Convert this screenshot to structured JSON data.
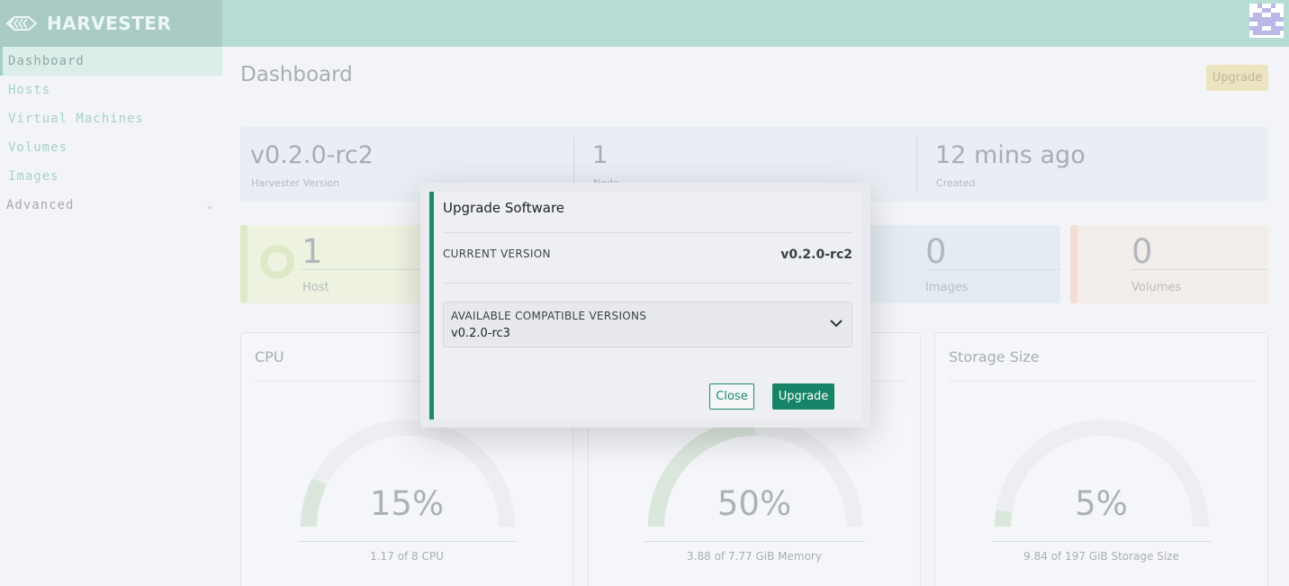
{
  "header": {
    "brand_name": "HARVESTER",
    "logo_icon": "harvester-logo-icon",
    "avatar_icon": "user-avatar-icon",
    "bar_color": "#b6ddd5"
  },
  "sidebar": {
    "items": [
      {
        "label": "Dashboard",
        "active": true
      },
      {
        "label": "Hosts"
      },
      {
        "label": "Virtual Machines"
      },
      {
        "label": "Volumes"
      },
      {
        "label": "Images"
      }
    ],
    "group": {
      "label": "Advanced",
      "icon": "chevron-down-icon"
    }
  },
  "main": {
    "title": "Dashboard",
    "upgrade_label": "Upgrade",
    "info": [
      {
        "value": "v0.2.0-rc2",
        "label": "Harvester Version"
      },
      {
        "value": "1",
        "label": "Node"
      },
      {
        "value": "12 mins ago",
        "label": "Created"
      }
    ],
    "stats": [
      {
        "value": "1",
        "label": "Host",
        "icon": "host-ring-icon",
        "color": "#dfe9c5"
      },
      {
        "value": "0",
        "label": "Images",
        "color": "#e4ecf3"
      },
      {
        "value": "0",
        "label": "Volumes",
        "color": "#f3e4df"
      }
    ],
    "gauges": [
      {
        "title": "CPU",
        "percent": "15%",
        "fraction": 0.15,
        "detail": "1.17 of 8 CPU"
      },
      {
        "title": "",
        "percent": "50%",
        "fraction": 0.5,
        "detail": "3.88 of 7.77 GiB Memory"
      },
      {
        "title": "Storage Size",
        "percent": "5%",
        "fraction": 0.05,
        "detail": "9.84 of 197 GiB Storage Size"
      }
    ]
  },
  "modal": {
    "title": "Upgrade Software",
    "current_version_label": "CURRENT VERSION",
    "current_version_value": "v0.2.0-rc2",
    "select_label": "AVAILABLE COMPATIBLE VERSIONS",
    "select_value": "v0.2.0-rc3",
    "select_icon": "chevron-down-icon",
    "close_label": "Close",
    "upgrade_label": "Upgrade",
    "accent": "#1d8a6e"
  }
}
